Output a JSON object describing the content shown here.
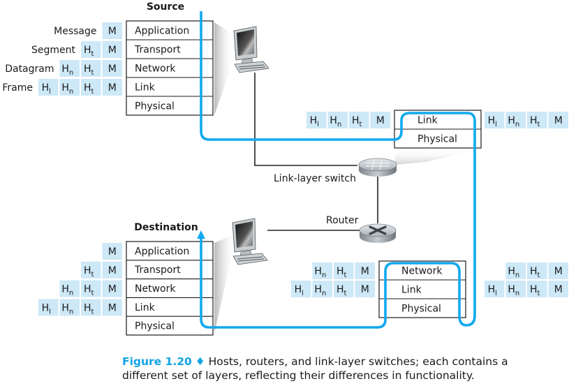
{
  "figure": {
    "number_label": "Figure 1.20",
    "separator": "♦",
    "caption_line1": "Hosts, routers, and link-layer switches; each contains a",
    "caption_line2": "different set of layers, reflecting their differences in functionality."
  },
  "colors": {
    "path": "#10a9ee",
    "header_fill": "#cde8f7",
    "stack_border": "#1a1a1a",
    "caption_accent": "#10a4e4"
  },
  "source": {
    "title": "Source",
    "layers": [
      "Application",
      "Transport",
      "Network",
      "Link",
      "Physical"
    ],
    "pdu_names": [
      "Message",
      "Segment",
      "Datagram",
      "Frame"
    ],
    "pdus": [
      [
        [
          "M",
          ""
        ]
      ],
      [
        [
          "H",
          "t"
        ],
        [
          "M",
          ""
        ]
      ],
      [
        [
          "H",
          "n"
        ],
        [
          "H",
          "t"
        ],
        [
          "M",
          ""
        ]
      ],
      [
        [
          "H",
          "l"
        ],
        [
          "H",
          "n"
        ],
        [
          "H",
          "t"
        ],
        [
          "M",
          ""
        ]
      ]
    ]
  },
  "switch": {
    "label": "Link-layer switch",
    "layers": [
      "Link",
      "Physical"
    ],
    "pdu_in": [
      [
        "H",
        "l"
      ],
      [
        "H",
        "n"
      ],
      [
        "H",
        "t"
      ],
      [
        "M",
        ""
      ]
    ],
    "pdu_out": [
      [
        "H",
        "l"
      ],
      [
        "H",
        "n"
      ],
      [
        "H",
        "t"
      ],
      [
        "M",
        ""
      ]
    ]
  },
  "router": {
    "label": "Router",
    "layers": [
      "Network",
      "Link",
      "Physical"
    ],
    "pdus_left": [
      [
        [
          "H",
          "n"
        ],
        [
          "H",
          "t"
        ],
        [
          "M",
          ""
        ]
      ],
      [
        [
          "H",
          "l"
        ],
        [
          "H",
          "n"
        ],
        [
          "H",
          "t"
        ],
        [
          "M",
          ""
        ]
      ]
    ],
    "pdus_right": [
      [
        [
          "H",
          "n"
        ],
        [
          "H",
          "t"
        ],
        [
          "M",
          ""
        ]
      ],
      [
        [
          "H",
          "l"
        ],
        [
          "H",
          "n"
        ],
        [
          "H",
          "t"
        ],
        [
          "M",
          ""
        ]
      ]
    ]
  },
  "destination": {
    "title": "Destination",
    "layers": [
      "Application",
      "Transport",
      "Network",
      "Link",
      "Physical"
    ],
    "pdus": [
      [
        [
          "M",
          ""
        ]
      ],
      [
        [
          "H",
          "t"
        ],
        [
          "M",
          ""
        ]
      ],
      [
        [
          "H",
          "n"
        ],
        [
          "H",
          "t"
        ],
        [
          "M",
          ""
        ]
      ],
      [
        [
          "H",
          "l"
        ],
        [
          "H",
          "n"
        ],
        [
          "H",
          "t"
        ],
        [
          "M",
          ""
        ]
      ]
    ]
  },
  "icons": {
    "source_host": "desktop-computer-icon",
    "destination_host": "desktop-computer-icon",
    "switch": "switch-icon",
    "router": "router-icon"
  }
}
